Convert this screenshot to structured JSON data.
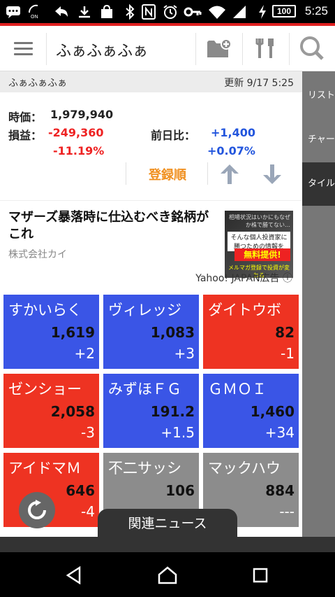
{
  "status_bar": {
    "time": "5:25",
    "battery": "100",
    "icons": [
      "chat-icon",
      "network-icon",
      "back-arrow-icon",
      "download-icon",
      "bag-icon",
      "bluetooth-icon",
      "nfc-icon",
      "alarm-icon",
      "key-icon",
      "wifi-icon",
      "signal-icon",
      "charging-icon"
    ]
  },
  "app_bar": {
    "title": "ふぁふぁふぁ"
  },
  "portfolio": {
    "name": "ふぁふぁふぁ",
    "updated": "更新 9/17 5:25",
    "price_label": "時価：",
    "price_value": "1,979,940",
    "pl_label": "損益：",
    "pl_value": "-249,360",
    "pl_percent": "-11.19%",
    "day_label": "前日比：",
    "day_value": "+1,400",
    "day_percent": "+0.07%",
    "sort_label": "登録順"
  },
  "side_tabs": [
    "リスト",
    "チャート",
    "タイル"
  ],
  "ad": {
    "headline": "マザーズ暴落時に仕込むべき銘柄がこれ",
    "company": "株式会社カイ",
    "label": "Yahoo! JAPAN広告",
    "img_text1": "相場状況はいかにもなぜか株で勝てない…",
    "img_text2": "そんな個人投資家に勝つための情報を",
    "img_text3": "無料提供!",
    "img_text4": "メルマガ登録で投資が変わる"
  },
  "tiles": [
    {
      "name": "すかいらく",
      "price": "1,619",
      "change": "+2",
      "color": "blue"
    },
    {
      "name": "ヴィレッジ",
      "price": "1,083",
      "change": "+3",
      "color": "blue"
    },
    {
      "name": "ダイトウボ",
      "price": "82",
      "change": "-1",
      "color": "red"
    },
    {
      "name": "ゼンショー",
      "price": "2,058",
      "change": "-3",
      "color": "red"
    },
    {
      "name": "みずほＦＧ",
      "price": "191.2",
      "change": "+1.5",
      "color": "blue"
    },
    {
      "name": "ＧＭＯＩ",
      "price": "1,460",
      "change": "+34",
      "color": "blue"
    },
    {
      "name": "アイドマＭ",
      "price": "646",
      "change": "-4",
      "color": "red"
    },
    {
      "name": "不二サッシ",
      "price": "106",
      "change": "",
      "color": "gray"
    },
    {
      "name": "マックハウ",
      "price": "884",
      "change": "---",
      "color": "gray"
    }
  ],
  "news_tab": "関連ニュース",
  "colors": {
    "accent_red": "#e02020",
    "positive": "#2255dd",
    "negative": "#e22222",
    "sort_orange": "#f09020"
  }
}
